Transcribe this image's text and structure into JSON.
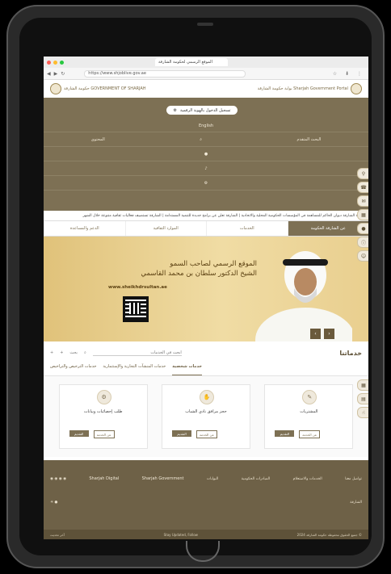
{
  "browser": {
    "tab_title": "الموقع الرسمي لحكومة الشارقة",
    "url": "https://www.shjoblive.gov.ae"
  },
  "site": {
    "logo_left": "حكومة الشارقة\nGOVERNMENT OF SHARJAH",
    "logo_right": "بوابة حكومة الشارقة\nSharjah Government Portal"
  },
  "header": {
    "search_pill": "تسجيل الدخول بالهوية الرقمية",
    "language": "English",
    "field_label": "المحتوى",
    "field_label2": "البحث المتقدم"
  },
  "ticker": "برعاية الشارقة ديوان الحاكم للمساهمة في المؤسسات الحكومية المحلية والاتحادية | الشارقة تعلن عن برامج جديدة للتنمية المستدامة | الشارقة تستضيف فعاليات ثقافية متنوعة خلال الشهر",
  "menu": [
    "عن الشارقة الحكومة",
    "الخدمات",
    "الموارد الثقافية",
    "الدعم والمساعدة"
  ],
  "hero": {
    "title_line1": "الموقع الرسمي لصاحب السمو",
    "title_line2": "الشيخ الدكتور سلطان بن محمد القاسمي",
    "url": "www.sheikhdrsultan.ae"
  },
  "services": {
    "title": "خدماتنا",
    "search_placeholder": "ابحث في الخدمات",
    "search_label": "بحث",
    "categories": [
      "خدمات شخصية",
      "خدمات المنشآت التجارية والإستثمارية",
      "خدمات الترخيص والتراخيص",
      "التراخيص"
    ],
    "cards": [
      {
        "icon": "document-icon",
        "title": "المشتريات",
        "apply": "التقديم",
        "details": "عن الخدمة"
      },
      {
        "icon": "hand-icon",
        "title": "حجز مرافق نادي الشباب",
        "apply": "التقديم",
        "details": "عن الخدمة"
      },
      {
        "icon": "gear-icon",
        "title": "طلب إحصائيات وبيانات",
        "apply": "التقديم",
        "details": "عن الخدمة"
      }
    ]
  },
  "side_icons": [
    "accessibility-icon",
    "phone-icon",
    "chat-icon",
    "calendar-icon",
    "mic-icon",
    "info-icon",
    "person-icon"
  ],
  "footer": {
    "logos": [
      "الشارقة",
      "Sharjah Digital",
      "Sharjah Government"
    ],
    "links": [
      "تواصل معنا",
      "الخدمات والاستعلام",
      "المبادرات الحكومية",
      "البوابات"
    ],
    "bottom_left": "جميع الحقوق محفوظة حكومة الشارقة 2024 ©",
    "bottom_mid": "Stay Updated, Follow",
    "bottom_right": "آخر تحديث"
  }
}
